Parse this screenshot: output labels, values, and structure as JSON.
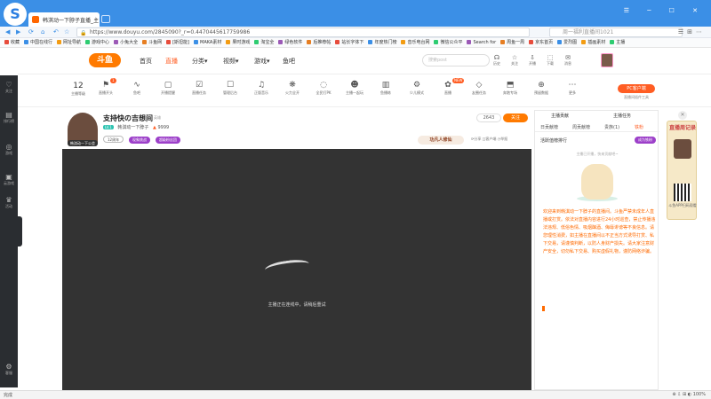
{
  "browser": {
    "logo": "S",
    "tab_title": "韩淇动一下脖子直播_主",
    "url": "https://www.douyu.com/2845090?_r=0.4470445617759986",
    "search_placeholder": "周一福利直播间1021",
    "win_controls": "☰ ─ ☐ ✕"
  },
  "bookmarks": [
    "收藏",
    "中国在线行",
    "网址导航",
    "游戏中心",
    "小兔大全",
    "斗鱼网",
    "[斯坦能]",
    "MAKA素材",
    "果时游戏",
    "淘宝全",
    "绿色软件",
    "后推荐帖",
    "站长字体下",
    "年度热门榜",
    "音乐电台网",
    "微信公众平",
    "Search for",
    "周鱼一周",
    "京东首页",
    "爱烈图",
    "插画素材",
    "主播"
  ],
  "site": {
    "logo": "斗鱼",
    "nav": [
      "首页",
      "直播",
      "分类▾",
      "视频▾",
      "游戏▾",
      "鱼吧"
    ],
    "search_placeholder": "搜索post",
    "header_icons": [
      {
        "icon": "☊",
        "label": "历史"
      },
      {
        "icon": "☆",
        "label": "关注"
      },
      {
        "icon": "⇩",
        "label": "开播"
      },
      {
        "icon": "⬚",
        "label": "下载"
      },
      {
        "icon": "✉",
        "label": "消息"
      }
    ]
  },
  "sidebar": [
    {
      "icon": "♡",
      "label": "关注"
    },
    {
      "icon": "▤",
      "label": "排行榜"
    },
    {
      "icon": "◎",
      "label": "游戏"
    },
    {
      "icon": "▣",
      "label": "云游戏"
    },
    {
      "icon": "♛",
      "label": "活动"
    },
    {
      "icon": "⚙",
      "label": "客服"
    }
  ],
  "category": {
    "level": "12",
    "level_label": "主播等级",
    "items": [
      {
        "icon": "⚑",
        "label": "直播开头",
        "badge": "1"
      },
      {
        "icon": "∿",
        "label": "鱼吧"
      },
      {
        "icon": "▢",
        "label": "开播提醒"
      },
      {
        "icon": "☑",
        "label": "直播任务"
      },
      {
        "icon": "☐",
        "label": "管理后台"
      },
      {
        "icon": "♫",
        "label": "正版音乐"
      },
      {
        "icon": "❋",
        "label": "火力全开"
      },
      {
        "icon": "◌",
        "label": "全民打PK"
      },
      {
        "icon": "☻",
        "label": "主播一起玩"
      },
      {
        "icon": "▥",
        "label": "鱼播练"
      },
      {
        "icon": "⚙",
        "label": "少儿模式"
      },
      {
        "icon": "✿",
        "label": "直播",
        "badge": "NEW"
      },
      {
        "icon": "◇",
        "label": "友圈任务"
      },
      {
        "icon": "⬒",
        "label": "奔跑专场"
      },
      {
        "icon": "⊕",
        "label": "预留数据"
      },
      {
        "icon": "⋯",
        "label": "更多"
      }
    ],
    "pc_button": "PC客户端",
    "pc_sub": "直播间插件工具"
  },
  "room": {
    "title": "支持快の吉想间",
    "tag": "英雄",
    "meta_level": "LV.1",
    "streamer": "韩淇动一下脖子",
    "hot": "9999",
    "avatar_label": "韩淇动一下公会",
    "actions": [
      "12周年",
      "现象挑战",
      "超级粉丝团"
    ],
    "fans": "2643",
    "follow": "关注",
    "brand": "功凡人修仙",
    "links": "⟳分享  ◫客户端  ◷举报"
  },
  "player": {
    "status": "主播正在连线中，请稍后重试"
  },
  "right_panel": {
    "top_tabs": [
      "主播贡献",
      "主播任务"
    ],
    "tabs": [
      "日贡献榜",
      "周贡献榜",
      "贵族(1)",
      "铁粉"
    ],
    "subtitle": "活跃值榜排行",
    "action_btn": "成为铁粉",
    "empty_text": "主播已开播，快来贡献吧~",
    "notice": "欢迎来到韩淇动一下脖子的直播间。斗鱼严禁未成年人直播或打赏。依法对直播内容进行24小时巡查，禁止传播违法违规、低俗色情、吸烟酗酒、侮辱诽谤等不良信息。请您理性消费，如主播在直播间以不正当方式诱导打赏、私下交易，请谨慎判断，以防人身财产损失。请大家注意财产安全，切勿私下交易、购买虚假礼物，谨防网络诈骗。"
  },
  "ad": {
    "title": "直播周记录",
    "text": "斗鱼APP扫码观看"
  },
  "status": {
    "left": "完成",
    "right": "⊕ ⇩ ⊞ ◐ 100%"
  },
  "colors": {
    "accent": "#ff5d23",
    "browser_blue": "#3b8fe6"
  }
}
